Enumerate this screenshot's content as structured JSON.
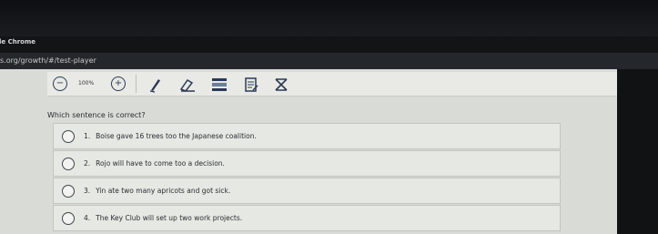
{
  "window": {
    "title": "gle Chrome"
  },
  "address_bar": {
    "url": "s.org/growth/#/test-player"
  },
  "toolbar": {
    "zoom_out_icon": "minus-circle-icon",
    "zoom_level": "100%",
    "zoom_in_icon": "plus-circle-icon",
    "tools": [
      "pencil-icon",
      "eraser-icon",
      "highlighter-icon",
      "notepad-icon",
      "answer-eliminator-icon"
    ]
  },
  "question": {
    "prompt": "Which sentence is correct?"
  },
  "choices": [
    {
      "number": "1.",
      "text": "Boise gave 16 trees too the Japanese coalition."
    },
    {
      "number": "2.",
      "text": "Rojo will have to come too a decision."
    },
    {
      "number": "3.",
      "text": "Yin ate two many apricots and got sick."
    },
    {
      "number": "4.",
      "text": "The Key Club will set up two work projects."
    }
  ],
  "colors": {
    "accent": "#2b3a55",
    "page_bg": "#d9dbd6",
    "chrome_bg": "#121416"
  }
}
